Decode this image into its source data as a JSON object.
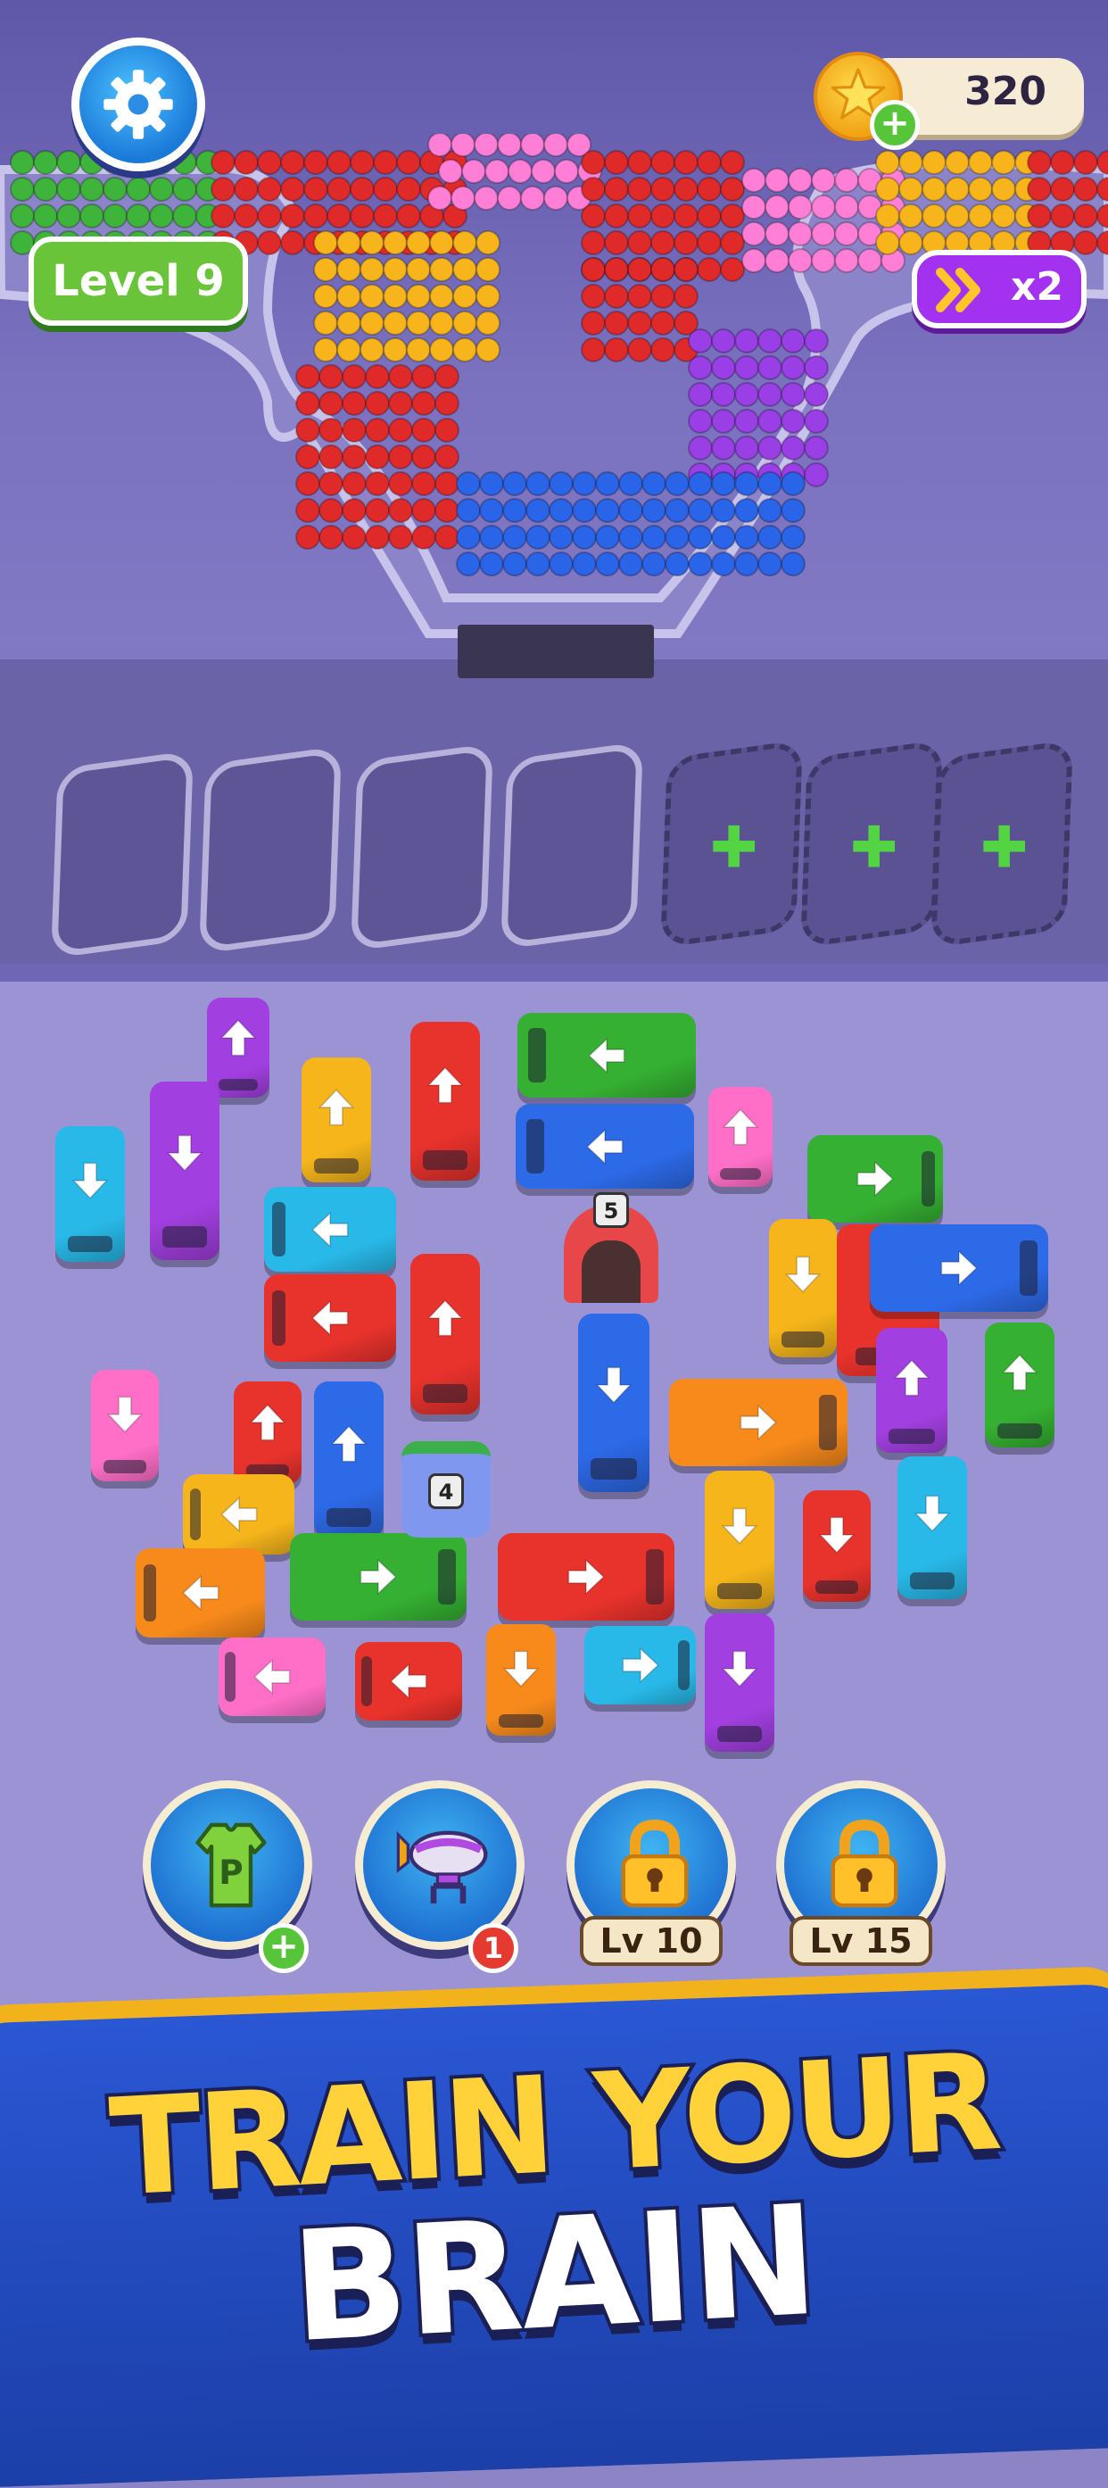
{
  "hud": {
    "level_label": "Level 9",
    "coins": "320",
    "speed_label": "x2",
    "settings_icon": "gear-icon",
    "coin_icon": "star-coin-icon",
    "speed_icon": "fast-forward-icon"
  },
  "slots": {
    "open_count": 4,
    "locked_count": 3,
    "locked_icon": "plus-icon"
  },
  "crowd": {
    "colors": [
      "#3fb43a",
      "#e02a2a",
      "#ff7fd6",
      "#f7b51b",
      "#9a3ee6",
      "#2a64e8"
    ]
  },
  "vehicles": [
    {
      "color": "#a23fe0",
      "dir": "up"
    },
    {
      "color": "#f5b51b",
      "dir": "up"
    },
    {
      "color": "#e8322c",
      "dir": "up"
    },
    {
      "color": "#35b032",
      "dir": "left"
    },
    {
      "color": "#2d6ae8",
      "dir": "left"
    },
    {
      "color": "#ff6fc8",
      "dir": "up"
    },
    {
      "color": "#35b032",
      "dir": "right"
    },
    {
      "color": "#29b9e8",
      "dir": "down"
    },
    {
      "color": "#a23fe0",
      "dir": "down"
    },
    {
      "color": "#29b9e8",
      "dir": "left"
    },
    {
      "color": "#e8322c",
      "dir": "down"
    },
    {
      "color": "#f5b51b",
      "dir": "down"
    },
    {
      "color": "#2d6ae8",
      "dir": "right"
    },
    {
      "color": "#e8322c",
      "dir": "left"
    },
    {
      "color": "#e8322c",
      "dir": "up"
    },
    {
      "color": "#2d6ae8",
      "dir": "down"
    },
    {
      "color": "#a23fe0",
      "dir": "up"
    },
    {
      "color": "#35b032",
      "dir": "up"
    },
    {
      "color": "#ff6fc8",
      "dir": "down"
    },
    {
      "color": "#e8322c",
      "dir": "up"
    },
    {
      "color": "#2d6ae8",
      "dir": "up"
    },
    {
      "color": "#f78a1b",
      "dir": "right"
    },
    {
      "color": "#f5b51b",
      "dir": "left"
    },
    {
      "color": "#f5b51b",
      "dir": "down"
    },
    {
      "color": "#e8322c",
      "dir": "down"
    },
    {
      "color": "#29b9e8",
      "dir": "down"
    },
    {
      "color": "#f78a1b",
      "dir": "left"
    },
    {
      "color": "#35b032",
      "dir": "right"
    },
    {
      "color": "#e8322c",
      "dir": "right"
    },
    {
      "color": "#ff6fc8",
      "dir": "left"
    },
    {
      "color": "#e8322c",
      "dir": "left"
    },
    {
      "color": "#f78a1b",
      "dir": "down"
    },
    {
      "color": "#29b9e8",
      "dir": "right"
    },
    {
      "color": "#a23fe0",
      "dir": "down"
    }
  ],
  "gates": [
    {
      "count": "5",
      "color": "#e8474a"
    },
    {
      "count": "4",
      "color": "#6f8ef0"
    }
  ],
  "boosters": [
    {
      "icon": "parking-shirt-icon",
      "badge": "+"
    },
    {
      "icon": "blimp-magnet-icon",
      "badge": "1"
    },
    {
      "icon": "padlock-icon",
      "tag": "Lv 10"
    },
    {
      "icon": "padlock-icon",
      "tag": "Lv 15"
    }
  ],
  "banner": {
    "line1": "TRAIN YOUR",
    "line2": "BRAIN"
  }
}
